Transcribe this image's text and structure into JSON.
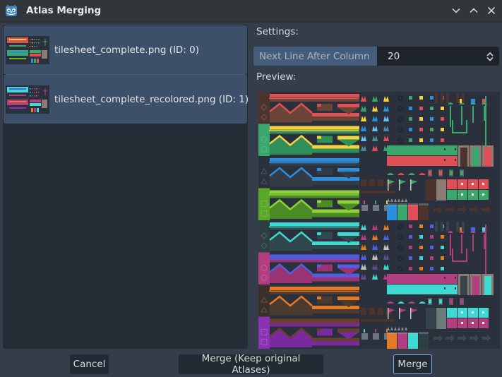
{
  "window": {
    "title": "Atlas Merging",
    "icon": "godot-engine-icon",
    "controls": [
      "minimize-icon",
      "maximize-icon",
      "close-icon"
    ]
  },
  "atlas_list": {
    "items": [
      {
        "label": "tilesheet_complete.png (ID: 0)",
        "selected": true,
        "thumbnail_palette": [
          "#e04f55",
          "#f5d33c",
          "#3aa76d",
          "#2b8fe0",
          "#66b92e"
        ]
      },
      {
        "label": "tilesheet_complete_recolored.png (ID: 1)",
        "selected": true,
        "thumbnail_palette": [
          "#3fd9d3",
          "#4f5ee6",
          "#b23d7f",
          "#e67b25",
          "#8b31b5"
        ]
      }
    ]
  },
  "settings": {
    "heading": "Settings:",
    "property": {
      "label": "Next Line After Column",
      "value": "20"
    }
  },
  "preview": {
    "heading": "Preview:",
    "terrain_rows": [
      {
        "bg": "#4c342c",
        "top": "#e04f55",
        "under": "#6b4438",
        "band": "dirt-red",
        "emblem": "diamond"
      },
      {
        "bg": "#3aa76d",
        "top": "#f5d33c",
        "under": "#2f8f5a",
        "band": "grass-yellow",
        "emblem": "circle"
      },
      {
        "bg": "#2a313c",
        "top": "#2b8fe0",
        "under": "#333b47",
        "band": "ice-blue",
        "emblem": "triangle"
      },
      {
        "bg": "#5aa72a",
        "top": "#8fd13a",
        "under": "#4b8b24",
        "band": "grass-lime",
        "emblem": "square"
      },
      {
        "bg": "#2d3f43",
        "top": "#3fd9d3",
        "under": "#30474b",
        "band": "cyan-dark",
        "emblem": "diamond"
      },
      {
        "bg": "#b23d7f",
        "top": "#4f5ee6",
        "under": "#9a3470",
        "band": "blue-magenta",
        "emblem": "circle"
      },
      {
        "bg": "#3b3028",
        "top": "#e67b25",
        "under": "#4a3a2f",
        "band": "orange-dark",
        "emblem": "triangle"
      },
      {
        "bg": "#8b31b5",
        "top": "#6b3f2c",
        "under": "#7a2aa0",
        "band": "brown-purple",
        "emblem": "square"
      }
    ],
    "sprite_palettes": [
      [
        "#e04f55",
        "#3aa76d",
        "#f5d33c",
        "#2b8fe0",
        "#67c3f3",
        "#4a8a9a"
      ],
      [
        "#3fd9d3",
        "#b23d7f",
        "#e67b25",
        "#4f5ee6",
        "#c0c0c0",
        "#5a4f8a"
      ]
    ],
    "block_palettes": [
      {
        "a": "#3aa76d",
        "b": "#e04f55",
        "wood": "#4c342c",
        "crate": "#8c7b74"
      },
      {
        "a": "#b23d7f",
        "b": "#3fd9d3",
        "wood": "#34444a",
        "crate": "#6d7b7b"
      }
    ],
    "water_colors": [
      [
        "#2b8fe0",
        "#3aa76d",
        "#e04f55",
        "#4c342c"
      ],
      [
        "#e67b25",
        "#b23d7f",
        "#3fd9d3",
        "#2d3f43"
      ]
    ]
  },
  "buttons": {
    "cancel": "Cancel",
    "merge_keep": "Merge (Keep original Atlases)",
    "merge": "Merge"
  }
}
